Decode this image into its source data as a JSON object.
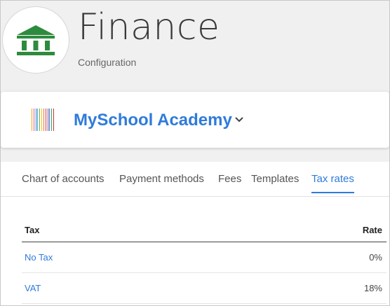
{
  "app": {
    "title": "Finance",
    "subtitle": "Configuration",
    "logo_icon": "bank-icon",
    "accent_color": "#2e8b3e"
  },
  "school": {
    "name": "MySchool Academy",
    "logo_icon": "barcode-stripes-icon",
    "logo_colors": [
      "#f2a900",
      "#e25a9c",
      "#4a6fd6",
      "#25b6c9",
      "#5cb85c",
      "#f2c200",
      "#e8742d",
      "#d13a3a",
      "#8e44ad",
      "#3a7bd5",
      "#27ae60",
      "#c0392b"
    ],
    "name_color": "#2f7bdb",
    "dropdown_icon": "chevron-down-icon"
  },
  "tabs": [
    {
      "label": "Chart of accounts",
      "active": false
    },
    {
      "label": "Payment methods",
      "active": false
    },
    {
      "label": "Fees",
      "active": false
    },
    {
      "label": "Templates",
      "active": false
    },
    {
      "label": "Tax rates",
      "active": true
    }
  ],
  "table": {
    "columns": [
      "Tax",
      "Rate"
    ],
    "rows": [
      {
        "name": "No Tax",
        "rate": "0%"
      },
      {
        "name": "VAT",
        "rate": "18%"
      }
    ]
  }
}
